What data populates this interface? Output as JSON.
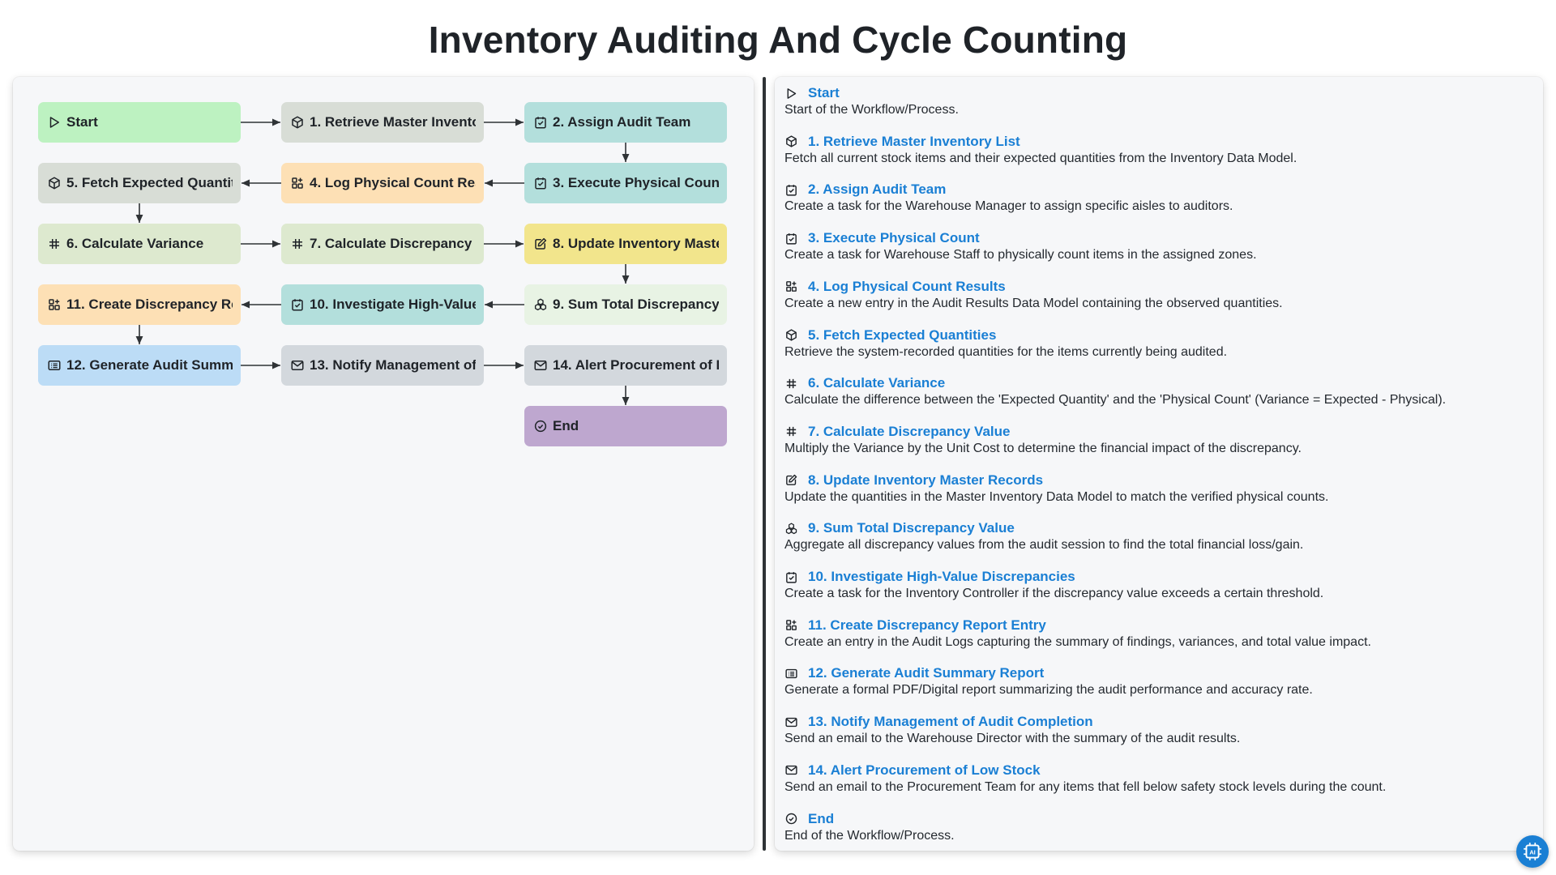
{
  "title": "Inventory Auditing And Cycle Counting",
  "colors": {
    "start": "#bdf2c1",
    "box": "#d8ddd6",
    "task": "#b3dfdc",
    "data": "#fde0b5",
    "calc": "#dde9cf",
    "update": "#f2e58c",
    "sum": "#e8f3e4",
    "report": "#bcdcf6",
    "email": "#d3d8dd",
    "end": "#bea7cf",
    "link": "#1a7fd4"
  },
  "nodes": [
    {
      "id": "start",
      "label": "Start",
      "icon": "play-icon",
      "color": "#bdf2c1"
    },
    {
      "id": "n1",
      "label": "1. Retrieve Master Inventory List",
      "icon": "cube-icon",
      "color": "#d8ddd6"
    },
    {
      "id": "n2",
      "label": "2. Assign Audit Team",
      "icon": "task-check-icon",
      "color": "#b3dfdc"
    },
    {
      "id": "n3",
      "label": "3. Execute Physical Count",
      "icon": "task-check-icon",
      "color": "#b3dfdc"
    },
    {
      "id": "n4",
      "label": "4. Log Physical Count Results",
      "icon": "data-grid-icon",
      "color": "#fde0b5"
    },
    {
      "id": "n5",
      "label": "5. Fetch Expected Quantities",
      "icon": "cube-icon",
      "color": "#d8ddd6"
    },
    {
      "id": "n6",
      "label": "6. Calculate Variance",
      "icon": "calculator-hash-icon",
      "color": "#dde9cf"
    },
    {
      "id": "n7",
      "label": "7. Calculate Discrepancy Value",
      "icon": "calculator-hash-icon",
      "color": "#dde9cf"
    },
    {
      "id": "n8",
      "label": "8. Update Inventory Master Records",
      "icon": "edit-icon",
      "color": "#f2e58c"
    },
    {
      "id": "n9",
      "label": "9. Sum Total Discrepancy Value",
      "icon": "aggregate-icon",
      "color": "#e8f3e4"
    },
    {
      "id": "n10",
      "label": "10. Investigate High-Value Discrepancies",
      "icon": "task-check-icon",
      "color": "#b3dfdc"
    },
    {
      "id": "n11",
      "label": "11. Create Discrepancy Report Entry",
      "icon": "data-grid-icon",
      "color": "#fde0b5"
    },
    {
      "id": "n12",
      "label": "12. Generate Audit Summary Report",
      "icon": "report-icon",
      "color": "#bcdcf6"
    },
    {
      "id": "n13",
      "label": "13. Notify Management of Audit Completion",
      "icon": "mail-icon",
      "color": "#d3d8dd"
    },
    {
      "id": "n14",
      "label": "14. Alert Procurement of Low Stock",
      "icon": "mail-icon",
      "color": "#d3d8dd"
    },
    {
      "id": "end",
      "label": "End",
      "icon": "check-circle-icon",
      "color": "#bea7cf"
    }
  ],
  "steps": [
    {
      "title": "Start",
      "icon": "play-icon",
      "desc": "Start of the Workflow/Process."
    },
    {
      "title": "1. Retrieve Master Inventory List",
      "icon": "cube-icon",
      "desc": "Fetch all current stock items and their expected quantities from the Inventory Data Model."
    },
    {
      "title": "2. Assign Audit Team",
      "icon": "task-check-icon",
      "desc": "Create a task for the Warehouse Manager to assign specific aisles to auditors."
    },
    {
      "title": "3. Execute Physical Count",
      "icon": "task-check-icon",
      "desc": "Create a task for Warehouse Staff to physically count items in the assigned zones."
    },
    {
      "title": "4. Log Physical Count Results",
      "icon": "data-grid-icon",
      "desc": "Create a new entry in the Audit Results Data Model containing the observed quantities."
    },
    {
      "title": "5. Fetch Expected Quantities",
      "icon": "cube-icon",
      "desc": "Retrieve the system-recorded quantities for the items currently being audited."
    },
    {
      "title": "6. Calculate Variance",
      "icon": "calculator-hash-icon",
      "desc": "Calculate the difference between the 'Expected Quantity' and the 'Physical Count' (Variance = Expected - Physical)."
    },
    {
      "title": "7. Calculate Discrepancy Value",
      "icon": "calculator-hash-icon",
      "desc": "Multiply the Variance by the Unit Cost to determine the financial impact of the discrepancy."
    },
    {
      "title": "8. Update Inventory Master Records",
      "icon": "edit-icon",
      "desc": "Update the quantities in the Master Inventory Data Model to match the verified physical counts."
    },
    {
      "title": "9. Sum Total Discrepancy Value",
      "icon": "aggregate-icon",
      "desc": "Aggregate all discrepancy values from the audit session to find the total financial loss/gain."
    },
    {
      "title": "10. Investigate High-Value Discrepancies",
      "icon": "task-check-icon",
      "desc": "Create a task for the Inventory Controller if the discrepancy value exceeds a certain threshold."
    },
    {
      "title": "11. Create Discrepancy Report Entry",
      "icon": "data-grid-icon",
      "desc": "Create an entry in the Audit Logs capturing the summary of findings, variances, and total value impact."
    },
    {
      "title": "12. Generate Audit Summary Report",
      "icon": "report-icon",
      "desc": "Generate a formal PDF/Digital report summarizing the audit performance and accuracy rate."
    },
    {
      "title": "13. Notify Management of Audit Completion",
      "icon": "mail-icon",
      "desc": "Send an email to the Warehouse Director with the summary of the audit results."
    },
    {
      "title": "14. Alert Procurement of Low Stock",
      "icon": "mail-icon",
      "desc": "Send an email to the Procurement Team for any items that fell below safety stock levels during the count."
    },
    {
      "title": "End",
      "icon": "check-circle-icon",
      "desc": "End of the Workflow/Process."
    }
  ],
  "edges": [
    [
      "start",
      "n1"
    ],
    [
      "n1",
      "n2"
    ],
    [
      "n2",
      "n3"
    ],
    [
      "n3",
      "n4"
    ],
    [
      "n4",
      "n5"
    ],
    [
      "n5",
      "n6"
    ],
    [
      "n6",
      "n7"
    ],
    [
      "n7",
      "n8"
    ],
    [
      "n8",
      "n9"
    ],
    [
      "n9",
      "n10"
    ],
    [
      "n10",
      "n11"
    ],
    [
      "n11",
      "n12"
    ],
    [
      "n12",
      "n13"
    ],
    [
      "n13",
      "n14"
    ],
    [
      "n14",
      "end"
    ]
  ]
}
